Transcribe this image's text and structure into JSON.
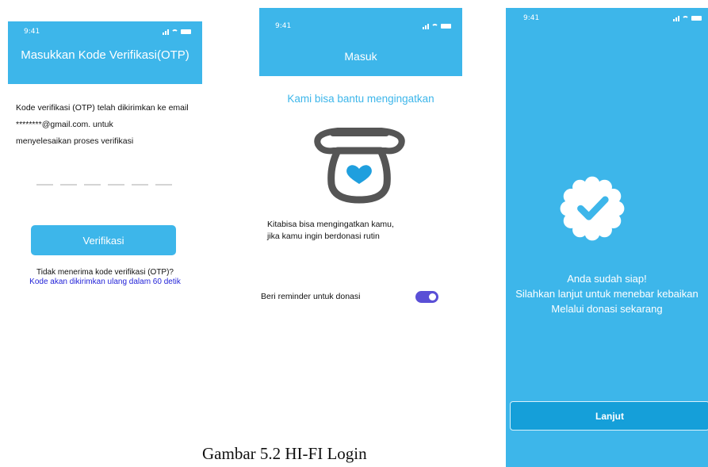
{
  "otp_screen": {
    "time": "9:41",
    "title": "Masukkan Kode Verifikasi(OTP)",
    "line1": "Kode verifikasi (OTP) telah dikirimkan ke email",
    "line2": "********@gmail.com. untuk",
    "line3": "menyelesaikan proses verifikasi",
    "otp_digits": 6,
    "verify_label": "Verifikasi",
    "resend_question": "Tidak menerima kode verifikasi (OTP)?",
    "resend_notice": "Kode akan dikirimkan ulang dalam 60 detik"
  },
  "login_screen": {
    "time": "9:41",
    "title": "Masuk",
    "subtitle": "Kami bisa bantu mengingatkan",
    "desc_line1": "Kitabisa bisa mengingatkan kamu,",
    "desc_line2": "jika kamu ingin berdonasi rutin",
    "reminder_label": "Beri reminder untuk donasi",
    "reminder_on": true,
    "illustration_icon": "donation-jar-heart-icon"
  },
  "ready_screen": {
    "time": "9:41",
    "line1": "Anda sudah siap!",
    "line2": "Silahkan lanjut untuk menebar kebaikan",
    "line3": "Melalui donasi sekarang",
    "continue_label": "Lanjut",
    "badge_icon": "verified-badge-icon"
  },
  "caption": "Gambar 5.2 HI-FI Login",
  "colors": {
    "primary": "#3db6ea",
    "button_dark": "#159fd9",
    "toggle": "#5a4fd6",
    "link": "#2323d8"
  }
}
